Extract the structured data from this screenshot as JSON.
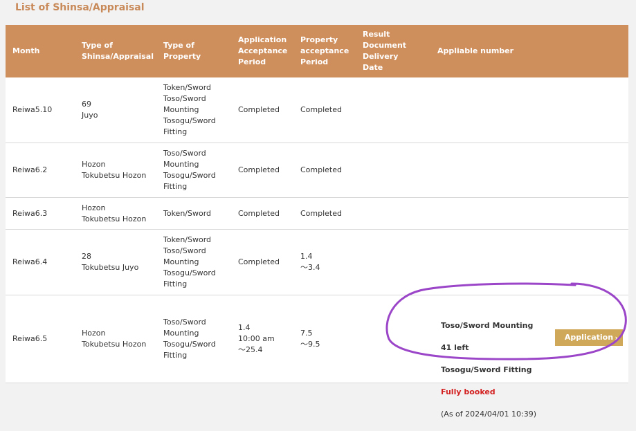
{
  "page_title": "List of Shinsa/Appraisal",
  "headers": [
    "Month",
    "Type of\nShinsa/Appraisal",
    "Type of\nProperty",
    "Application\nAcceptance\nPeriod",
    "Property\nacceptance\nPeriod",
    "Result\nDocument\nDelivery\nDate",
    "Appliable number"
  ],
  "rows": [
    [
      "Reiwa5.10",
      "69\nJuyo",
      "Token/Sword\nToso/Sword\nMounting\nTosogu/Sword\nFitting",
      "Completed",
      "Completed",
      "",
      ""
    ],
    [
      "Reiwa6.2",
      "Hozon\nTokubetsu Hozon",
      "Toso/Sword\nMounting\nTosogu/Sword\nFitting",
      "Completed",
      "Completed",
      "",
      ""
    ],
    [
      "Reiwa6.3",
      "Hozon\nTokubetsu Hozon",
      "Token/Sword",
      "Completed",
      "Completed",
      "",
      ""
    ],
    [
      "Reiwa6.4",
      "28\nTokubetsu Juyo",
      "Token/Sword\nToso/Sword\nMounting\nTosogu/Sword\nFitting",
      "Completed",
      "1.4\n～3.4",
      "",
      ""
    ],
    [
      "Reiwa6.5",
      "Hozon\nTokubetsu Hozon",
      "Toso/Sword\nMounting\nTosogu/Sword\nFitting",
      "1.4\n10:00 am\n～25.4",
      "7.5\n～9.5",
      "",
      ""
    ]
  ],
  "application": {
    "line1": "Toso/Sword Mounting",
    "line2": "41 left",
    "line3": "Tosogu/Sword Fitting",
    "status": "Fully booked",
    "as_of": "(As of 2024/04/01 10:39)",
    "button_label": "Application"
  },
  "colors": {
    "header_bg": "#cf8f5d",
    "title": "#c98a5a",
    "button_bg": "#cfa85a",
    "fully_booked": "#d32020",
    "annotation_circle": "#9b45c8"
  },
  "icons": {
    "button_chevron": "chevron-right-icon"
  }
}
